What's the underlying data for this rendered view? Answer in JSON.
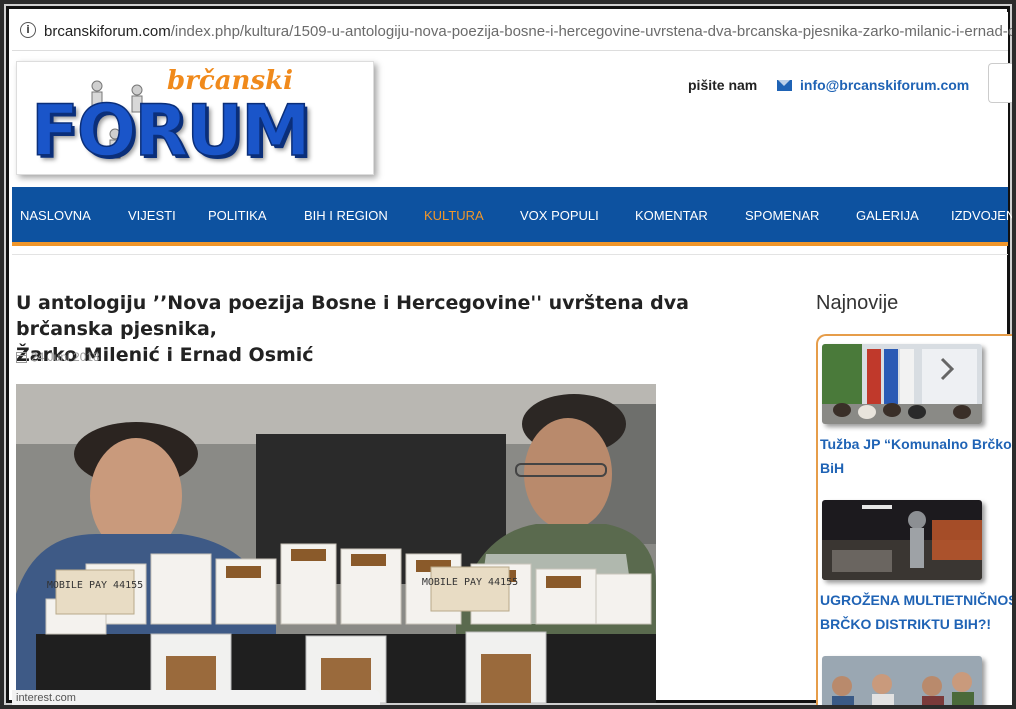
{
  "browser": {
    "url_host": "brcanskiforum.com",
    "url_path": "/index.php/kultura/1509-u-antologiju-nova-poezija-bosne-i-hercegovine-uvrstena-dva-brcanska-pjesnika-zarko-milanic-i-ernad-osmic",
    "info_icon": "info-circle-icon"
  },
  "header": {
    "logo_small": "brčanski",
    "logo_big": "FORUM",
    "write_label": "pišite nam",
    "email": "info@brcanskiforum.com",
    "email_icon": "envelope-icon"
  },
  "nav": {
    "items": [
      "NASLOVNA",
      "VIJESTI",
      "POLITIKA",
      "BIH I REGION",
      "KULTURA",
      "VOX POPULI",
      "KOMENTAR",
      "SPOMENAR",
      "GALERIJA",
      "IZDVOJEN"
    ],
    "active": "KULTURA",
    "bar_color": "#0d52a0",
    "accent_color": "#f0962a"
  },
  "article": {
    "title_line1": "U antologiju ’’Nova poezija Bosne i Hercegovine'' uvrštena dva brčanska pjesnika,",
    "title_line2": "Žarko Milenić i Ernad Osmić",
    "date": "24 Juni 2018",
    "date_icon": "calendar-icon",
    "photo_signs": [
      "MOBILE PAY 44155",
      "MOBILE PAY 44155"
    ],
    "attribution": "interest.com"
  },
  "sidebar": {
    "heading": "Najnovije",
    "items": [
      {
        "line1": "Tužba JP “Komunalno Brčko",
        "line2": "BiH"
      },
      {
        "line1": "UGROŽENA MULTIETNIČNOS",
        "line2": "BRČKO DISTRIKTU BIH?!"
      }
    ]
  }
}
